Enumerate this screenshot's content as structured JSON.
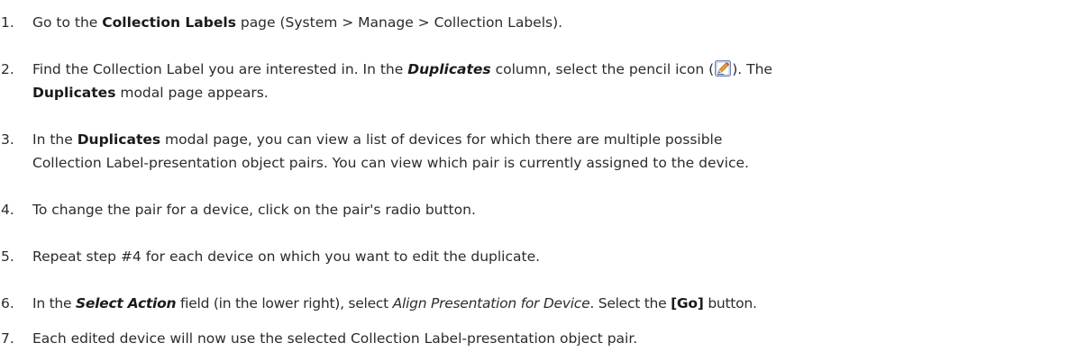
{
  "steps": [
    {
      "num": "1.",
      "a": "Go to the ",
      "b": "Collection Labels",
      "c": " page (System > Manage > Collection Labels)."
    },
    {
      "num": "2.",
      "a": "Find the Collection Label you are interested in. In the ",
      "b": "Duplicates",
      "c": " column, select the pencil icon (",
      "d": "). The",
      "line2_bold": "Duplicates",
      "line2_rest": " modal page appears.",
      "icon": "pencil-icon"
    },
    {
      "num": "3.",
      "a": "In the ",
      "b": "Duplicates",
      "c": " modal page, you can view a list of devices for which there are multiple possible",
      "line2_rest": "Collection Label-presentation object pairs. You can view which pair is currently assigned to the device."
    },
    {
      "num": "4.",
      "a": "To change the pair for a device, click on the pair's radio button."
    },
    {
      "num": "5.",
      "a": "Repeat step #4 for each device on which you want to edit the duplicate."
    },
    {
      "num": "6.",
      "a": "In the ",
      "b": "Select Action",
      "c": " field (in the lower right), select ",
      "d": "Align Presentation for Device",
      "e": ". Select the ",
      "f": "[Go]",
      "g": " button."
    },
    {
      "num": "7.",
      "a": "Each edited device will now use the selected Collection Label-presentation object pair."
    }
  ]
}
